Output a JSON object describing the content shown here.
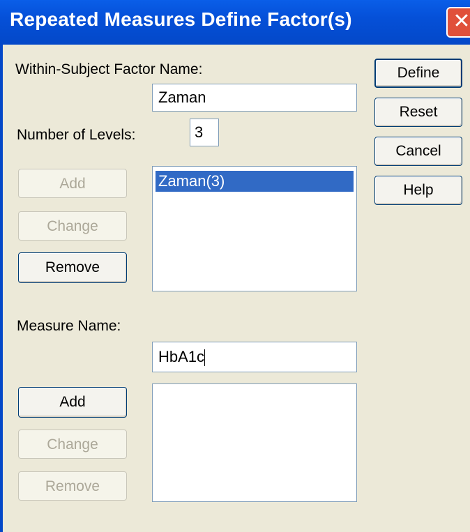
{
  "window": {
    "title": "Repeated Measures Define Factor(s)",
    "close_glyph": "✕"
  },
  "factor": {
    "name_label": "Within-Subject Factor Name:",
    "name_value": "Zaman",
    "levels_label": "Number of Levels:",
    "levels_value": "3",
    "buttons": {
      "add": "Add",
      "change": "Change",
      "remove": "Remove"
    },
    "list": [
      "Zaman(3)"
    ]
  },
  "measure": {
    "name_label": "Measure Name:",
    "name_value": "HbA1c",
    "buttons": {
      "add": "Add",
      "change": "Change",
      "remove": "Remove"
    },
    "list": []
  },
  "side_buttons": {
    "define": "Define",
    "reset": "Reset",
    "cancel": "Cancel",
    "help": "Help"
  },
  "colors": {
    "title_bar": "#0550d8",
    "selection": "#316ac5",
    "dialog_bg": "#ece9d8"
  }
}
